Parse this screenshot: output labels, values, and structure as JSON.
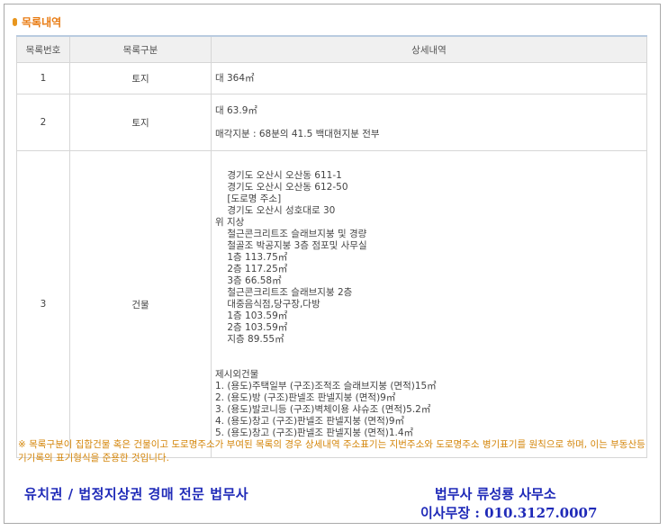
{
  "section": {
    "title": "목록내역"
  },
  "table": {
    "headers": [
      "목록번호",
      "목록구분",
      "상세내역"
    ],
    "rows": [
      {
        "num": "1",
        "type": "토지",
        "detail": "대 364㎡"
      },
      {
        "num": "2",
        "type": "토지",
        "detail": "대 63.9㎡\n\n매각지분 : 68분의 41.5 백대현지분 전부"
      },
      {
        "num": "3",
        "type": "건물",
        "detail": "    경기도 오산시 오산동 611-1\n    경기도 오산시 오산동 612-50\n    [도로명 주소]\n    경기도 오산시 성호대로 30\n위 지상\n    철근콘크리트조 슬래브지붕 및 경량\n    철골조 박공지붕 3층 점포및 사무실\n    1층 113.75㎡\n    2층 117.25㎡\n    3층 66.58㎡\n    철근콘크리트조 슬래브지붕 2층\n    대중음식점,당구장,다방\n    1층 103.59㎡\n    2층 103.59㎡\n    지층 89.55㎡\n\n\n제시외건물\n1. (용도)주택일부 (구조)조적조 슬래브지붕 (면적)15㎡\n2. (용도)방 (구조)판넬조 판넬지붕 (면적)9㎡\n3. (용도)발코니등 (구조)벽체이용 샤슈조 (면적)5.2㎡\n4. (용도)창고 (구조)판넬조 판넬지붕 (면적)9㎡\n5. (용도)창고 (구조)판넬조 판넬지붕 (면적)1.4㎡"
      }
    ]
  },
  "notice": "※ 목록구분이 집합건물 혹은 건물이고 도로명주소가 부여된 목록의 경우 상세내역 주소표기는 지번주소와 도로명주소 병기표기를 원칙으로 하며, 이는 부동산등기기록의 표기형식을 준용한 것입니다.",
  "footer": {
    "left": "유치권 / 법정지상권 경매 전문 법무사",
    "right_line1": "법무사 류성룡 사무소",
    "right_line2": "이사무장 : 010.3127.0007"
  },
  "colors": {
    "title": "#e87b12",
    "notice": "#d4860a",
    "footer": "#1f2ab8"
  }
}
